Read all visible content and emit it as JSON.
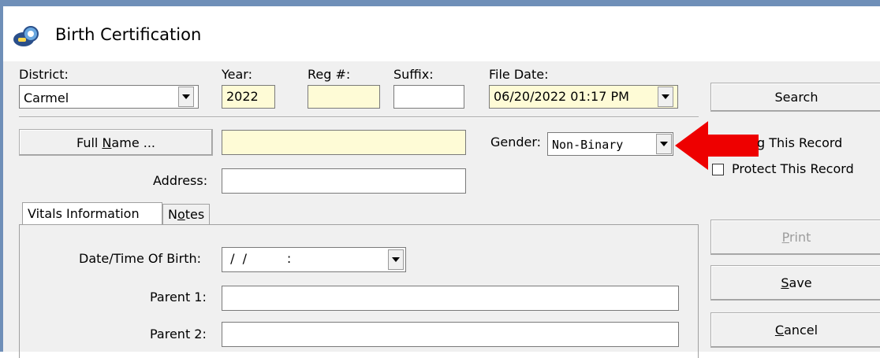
{
  "window": {
    "title": "Birth Certification",
    "app_icon": "pacifier-icon",
    "frame_color": "#6f8fb8"
  },
  "header": {
    "district": {
      "label": "District:",
      "value": "Carmel"
    },
    "year": {
      "label": "Year:",
      "value": "2022"
    },
    "reg": {
      "label": "Reg #:",
      "value": ""
    },
    "suffix": {
      "label": "Suffix:",
      "value": ""
    },
    "file_date": {
      "label": "File Date:",
      "value": "06/20/2022 01:17 PM"
    },
    "search_label": "Search"
  },
  "record": {
    "full_name_pre": "Full ",
    "full_name_accel": "N",
    "full_name_post": "ame ...",
    "full_name_value": "",
    "address_label": "Address:",
    "address_value": "",
    "gender_label": "Gender:",
    "gender_value": "Non-Binary",
    "flag_label": "g This Record",
    "protect_label": "Protect This Record",
    "protect_checked": false
  },
  "tabs": {
    "vitals": "Vitals Information",
    "notes_pre": "N",
    "notes_accel": "o",
    "notes_post": "tes"
  },
  "vitals": {
    "dob_label": "Date/Time Of Birth:",
    "dob_value": " /  /          :",
    "parent1_label": "Parent 1:",
    "parent1_value": "",
    "parent2_label": "Parent 2:",
    "parent2_value": ""
  },
  "actions": {
    "print_accel": "P",
    "print_rest": "rint",
    "save_accel": "S",
    "save_rest": "ave",
    "cancel_accel": "C",
    "cancel_rest": "ancel"
  },
  "annotation": {
    "arrow_color": "#ee0000",
    "icon": "arrow-left-icon"
  },
  "colors": {
    "required_field": "#fefbd6",
    "client_bg": "#f0f0f0"
  }
}
